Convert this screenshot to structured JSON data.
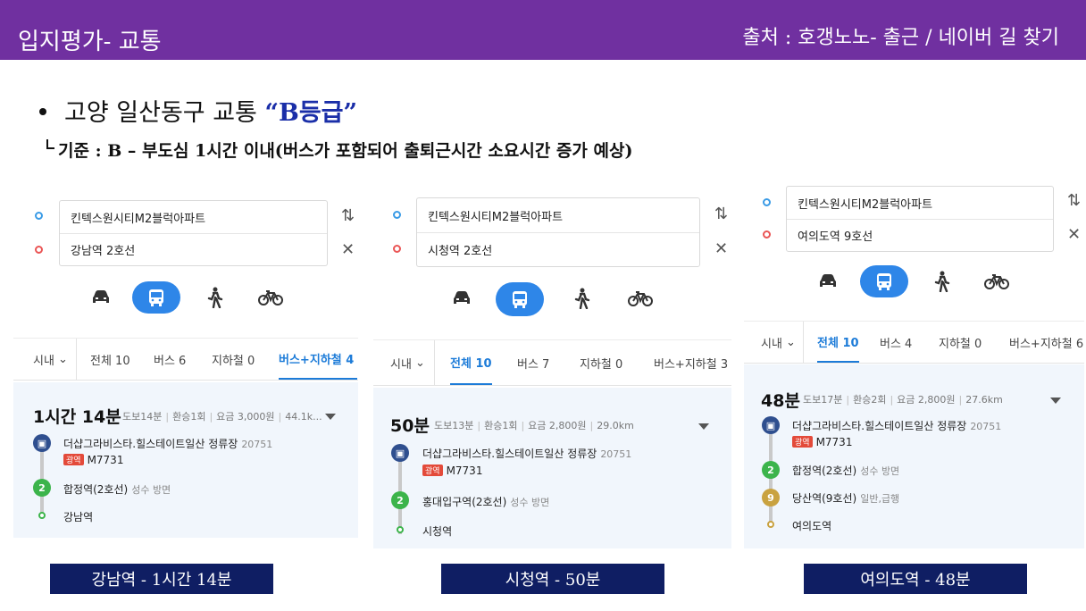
{
  "header": {
    "title": "입지평가- 교통",
    "source": "출처 : 호갱노노- 출근 / 네이버 길 찾기",
    "bg_color": "#7030a0"
  },
  "summary": {
    "bullet_prefix": "고양 일산동구 교통 ",
    "grade": "“B등급”",
    "criteria": "기준 : B – 부도심 1시간 이내(버스가 포함되어 출퇴근시간 소요시간 증가 예상)"
  },
  "panels": [
    {
      "origin": "킨텍스원시티M2블럭아파트",
      "destination": "강남역 2호선",
      "modes": [
        "car-icon",
        "bus-icon",
        "walk-icon",
        "bike-icon"
      ],
      "active_mode": "bus-icon",
      "tabs": [
        "시내",
        "전체 10",
        "버스 6",
        "지하철 0",
        "버스+지하철 4"
      ],
      "active_tab": 4,
      "duration": "1시간 14분",
      "meta": [
        "도보14분",
        "환승1회",
        "요금 3,000원",
        "44.1k..."
      ],
      "stops": [
        {
          "icon": "bus",
          "name": "더샵그라비스타.힐스테이트일산 정류장",
          "sub": "20751",
          "badge": "광역",
          "route": "M7731"
        },
        {
          "icon": "line2",
          "label": "2",
          "name": "합정역(2호선)",
          "sub": "성수 방면"
        },
        {
          "icon": "end",
          "name": "강남역"
        }
      ]
    },
    {
      "origin": "킨텍스원시티M2블럭아파트",
      "destination": "시청역 2호선",
      "modes": [
        "car-icon",
        "bus-icon",
        "walk-icon",
        "bike-icon"
      ],
      "active_mode": "bus-icon",
      "tabs": [
        "시내",
        "전체 10",
        "버스 7",
        "지하철 0",
        "버스+지하철 3"
      ],
      "active_tab": 1,
      "duration": "50분",
      "meta": [
        "도보13분",
        "환승1회",
        "요금 2,800원",
        "29.0km"
      ],
      "stops": [
        {
          "icon": "bus",
          "name": "더샵그라비스타.힐스테이트일산 정류장",
          "sub": "20751",
          "badge": "광역",
          "route": "M7731"
        },
        {
          "icon": "line2",
          "label": "2",
          "name": "홍대입구역(2호선)",
          "sub": "성수 방면"
        },
        {
          "icon": "end",
          "name": "시청역"
        }
      ]
    },
    {
      "origin": "킨텍스원시티M2블럭아파트",
      "destination": "여의도역 9호선",
      "modes": [
        "car-icon",
        "bus-icon",
        "walk-icon",
        "bike-icon"
      ],
      "active_mode": "bus-icon",
      "tabs": [
        "시내",
        "전체 10",
        "버스 4",
        "지하철 0",
        "버스+지하철 6"
      ],
      "active_tab": 1,
      "duration": "48분",
      "meta": [
        "도보17분",
        "환승2회",
        "요금 2,800원",
        "27.6km"
      ],
      "stops": [
        {
          "icon": "bus",
          "name": "더샵그라비스타.힐스테이트일산 정류장",
          "sub": "20751",
          "badge": "광역",
          "route": "M7731"
        },
        {
          "icon": "line2",
          "label": "2",
          "name": "합정역(2호선)",
          "sub": "성수 방면"
        },
        {
          "icon": "line9",
          "label": "9",
          "name": "당산역(9호선)",
          "sub": "일반,급행"
        },
        {
          "icon": "end",
          "name": "여의도역"
        }
      ]
    }
  ],
  "captions": [
    "강남역 - 1시간 14분",
    "시청역 - 50분",
    "여의도역 - 48분"
  ]
}
